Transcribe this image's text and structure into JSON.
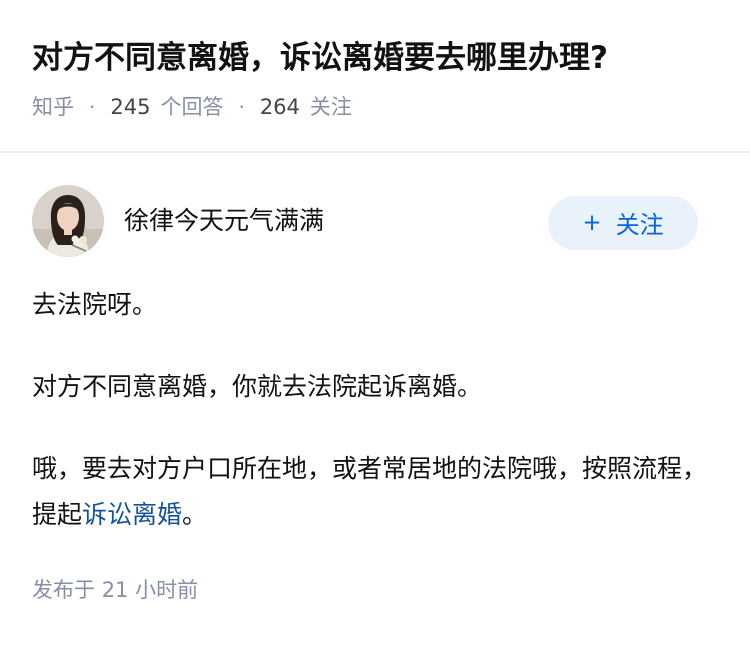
{
  "question": {
    "title": "对方不同意离婚，诉讼离婚要去哪里办理?",
    "source": "知乎",
    "answer_count": "245",
    "answer_label": "个回答",
    "follower_count": "264",
    "follower_label": "关注",
    "separator": "·"
  },
  "answer": {
    "author_name": "徐律今天元气满满",
    "follow_button_plus": "+",
    "follow_button_label": "关注",
    "paragraphs": [
      "去法院呀。",
      "对方不同意离婚，你就去法院起诉离婚。"
    ],
    "paragraph3_text": "哦，要去对方户口所在地，或者常居地的法院哦，按照流程，提起",
    "paragraph3_link": "诉讼离婚",
    "paragraph3_end": "。",
    "published_label": "发布于",
    "published_time": "21 小时前"
  },
  "colors": {
    "accent": "#0566d7",
    "link": "#175199",
    "meta": "#8590a6",
    "follow_bg": "#e9f1fb"
  },
  "icons": {
    "avatar": "author-avatar-photo"
  }
}
